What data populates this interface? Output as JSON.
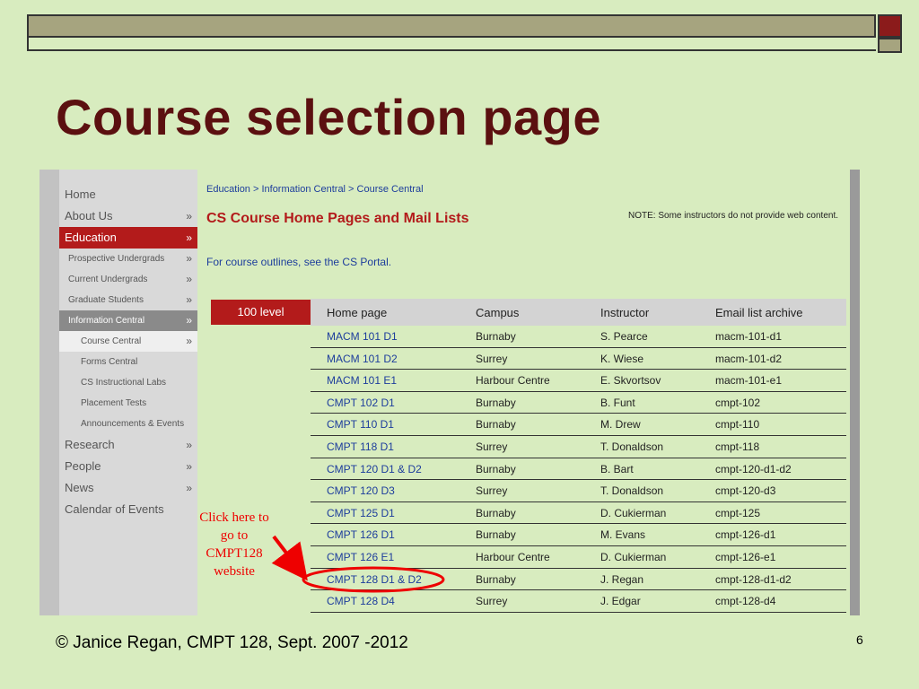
{
  "slide": {
    "title": "Course selection page",
    "footer": "© Janice Regan, CMPT 128, Sept. 2007 -2012",
    "page_number": "6",
    "annotation": "Click here to go to CMPT128 website"
  },
  "sidebar": {
    "items": [
      {
        "label": "Home",
        "arrow": ""
      },
      {
        "label": "About Us",
        "arrow": "»"
      },
      {
        "label": "Education",
        "arrow": "»"
      },
      {
        "label": "Prospective Undergrads",
        "arrow": "»"
      },
      {
        "label": "Current Undergrads",
        "arrow": "»"
      },
      {
        "label": "Graduate Students",
        "arrow": "»"
      },
      {
        "label": "Information Central",
        "arrow": "»"
      },
      {
        "label": "Course Central",
        "arrow": "»"
      },
      {
        "label": "Forms Central",
        "arrow": ""
      },
      {
        "label": "CS Instructional Labs",
        "arrow": ""
      },
      {
        "label": "Placement Tests",
        "arrow": ""
      },
      {
        "label": "Announcements & Events",
        "arrow": ""
      },
      {
        "label": "Research",
        "arrow": "»"
      },
      {
        "label": "People",
        "arrow": "»"
      },
      {
        "label": "News",
        "arrow": "»"
      },
      {
        "label": "Calendar of Events",
        "arrow": ""
      }
    ]
  },
  "content": {
    "breadcrumb": "Education > Information Central > Course Central",
    "heading": "CS Course Home Pages and Mail Lists",
    "note": "NOTE: Some instructors do not provide web content.",
    "outline_link": "For course outlines, see the CS Portal.",
    "level_tab": "100 level"
  },
  "table": {
    "headers": [
      "Home page",
      "Campus",
      "Instructor",
      "Email list archive"
    ],
    "rows": [
      [
        "MACM 101 D1",
        "Burnaby",
        "S. Pearce",
        "macm-101-d1"
      ],
      [
        "MACM 101 D2",
        "Surrey",
        "K. Wiese",
        "macm-101-d2"
      ],
      [
        "MACM 101 E1",
        "Harbour Centre",
        "E. Skvortsov",
        "macm-101-e1"
      ],
      [
        "CMPT 102 D1",
        "Burnaby",
        "B. Funt",
        "cmpt-102"
      ],
      [
        "CMPT 110 D1",
        "Burnaby",
        "M. Drew",
        "cmpt-110"
      ],
      [
        "CMPT 118 D1",
        "Surrey",
        "T. Donaldson",
        "cmpt-118"
      ],
      [
        "CMPT 120 D1 & D2",
        "Burnaby",
        "B. Bart",
        "cmpt-120-d1-d2"
      ],
      [
        "CMPT 120 D3",
        "Surrey",
        "T. Donaldson",
        "cmpt-120-d3"
      ],
      [
        "CMPT 125 D1",
        "Burnaby",
        "D. Cukierman",
        "cmpt-125"
      ],
      [
        "CMPT 126 D1",
        "Burnaby",
        "M. Evans",
        "cmpt-126-d1"
      ],
      [
        "CMPT 126 E1",
        "Harbour Centre",
        "D. Cukierman",
        "cmpt-126-e1"
      ],
      [
        "CMPT 128 D1 & D2",
        "Burnaby",
        "J. Regan",
        "cmpt-128-d1-d2"
      ],
      [
        "CMPT 128 D4",
        "Surrey",
        "J. Edgar",
        "cmpt-128-d4"
      ]
    ]
  },
  "colors": {
    "background": "#d8ecbf",
    "title": "#5b1010",
    "accent_red": "#b31b1b",
    "link": "#1d3d9c",
    "annotation": "#ee0000"
  }
}
